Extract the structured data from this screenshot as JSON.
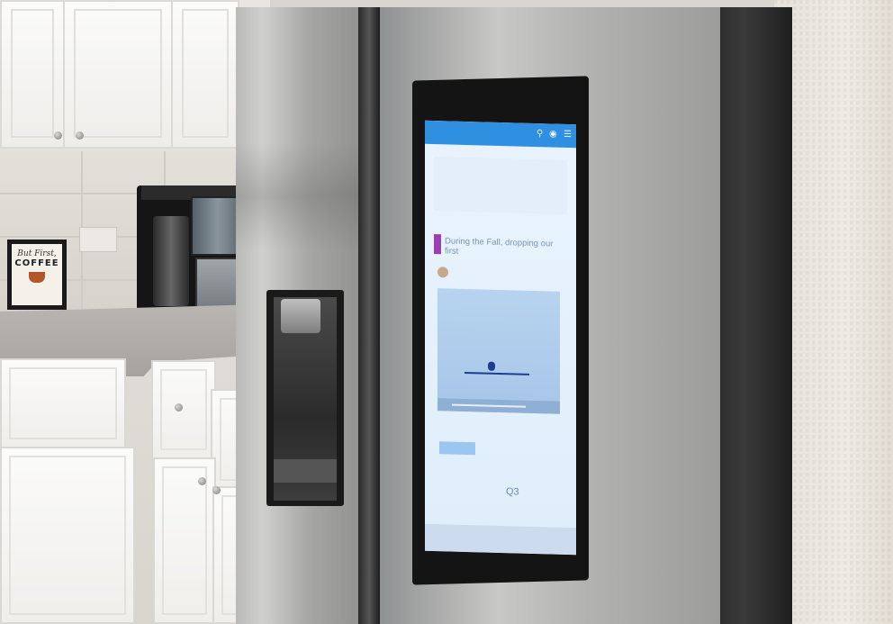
{
  "sign": {
    "line1": "But First,",
    "line2": "COFFEE"
  },
  "screen": {
    "post_text": "During the Fall, dropping our first",
    "bottom_label": "Q3"
  },
  "icons": [
    "search-icon",
    "tag-icon",
    "menu-icon",
    "mug-icon"
  ],
  "colors": {
    "topbar": "#2f8fe0",
    "post_accent": "#9b3fb5",
    "screen_bg": "#e3eefa"
  }
}
